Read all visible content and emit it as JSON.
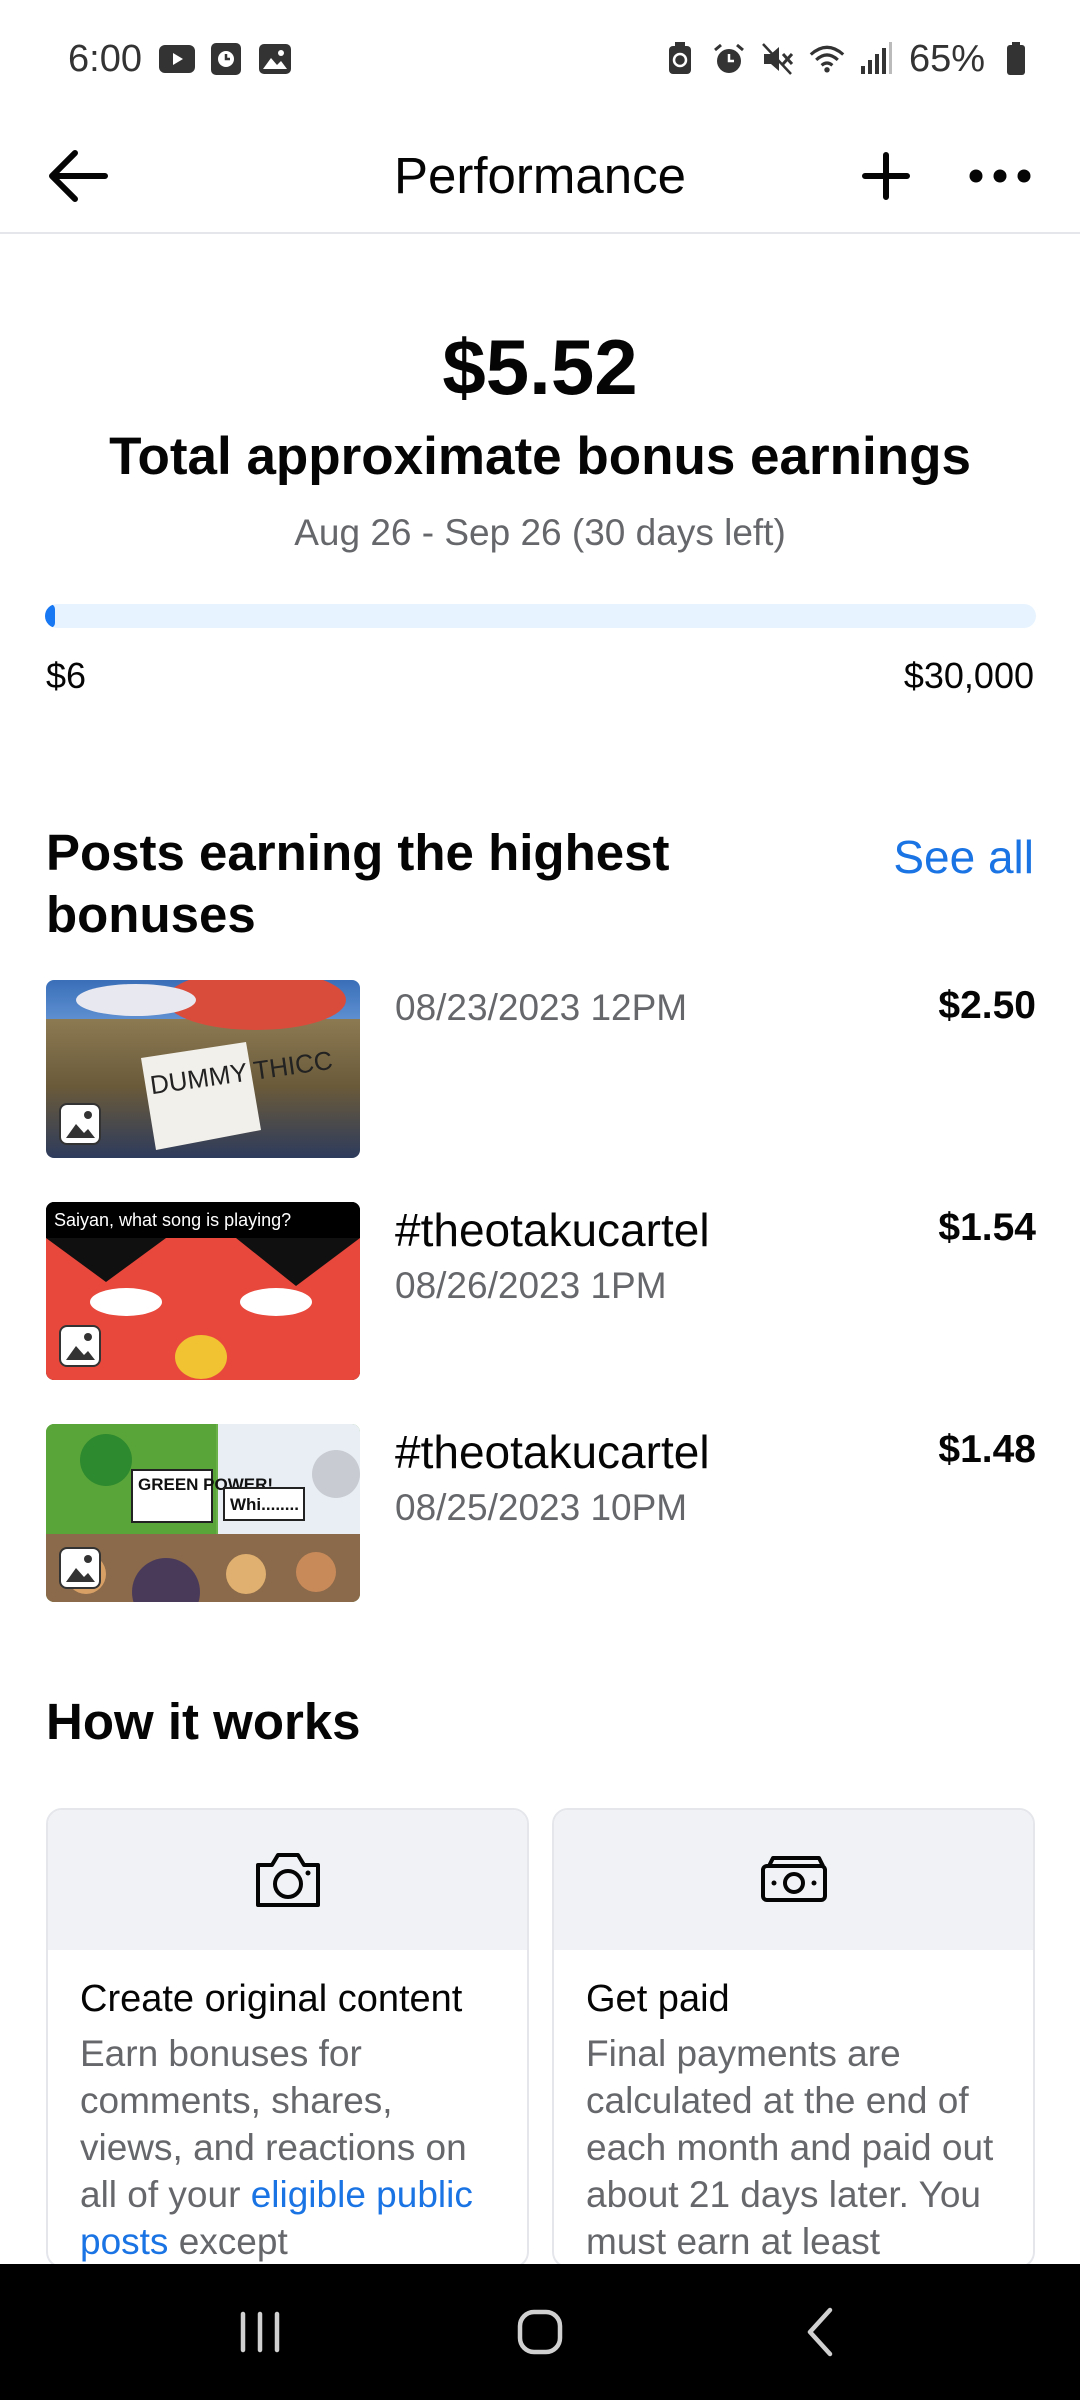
{
  "status_bar": {
    "time": "6:00",
    "battery": "65%",
    "left_icons": [
      "youtube-icon",
      "clock-app-icon",
      "gallery-icon"
    ],
    "right_icons": [
      "battery-saver-icon",
      "alarm-icon",
      "mute-icon",
      "wifi-icon",
      "signal-icon",
      "battery-icon"
    ]
  },
  "header": {
    "title": "Performance",
    "back_icon": "back-arrow-icon",
    "add_icon": "plus-icon",
    "more_icon": "more-icon"
  },
  "earnings": {
    "amount": "$5.52",
    "label": "Total approximate bonus earnings",
    "period": "Aug 26 - Sep 26 (30 days left)",
    "progress": {
      "fraction": 0.0002,
      "min_label": "$6",
      "max_label": "$30,000"
    }
  },
  "posts_section": {
    "heading": "Posts earning the highest bonuses",
    "see_all": "See all",
    "posts": [
      {
        "title": "",
        "date": "08/23/2023 12PM",
        "amount": "$2.50",
        "thumb_text": "DUMMY THICC"
      },
      {
        "title": "#theotakucartel",
        "date": "08/26/2023 1PM",
        "amount": "$1.54",
        "thumb_text": "Saiyan, what song is playing?"
      },
      {
        "title": "#theotakucartel",
        "date": "08/25/2023 10PM",
        "amount": "$1.48",
        "thumb_text": "GREEN POWER!",
        "thumb_text_2": "Whi........"
      }
    ]
  },
  "how_it_works": {
    "heading": "How it works",
    "cards": [
      {
        "icon": "camera-icon",
        "title": "Create original content",
        "body_before": "Earn bonuses for comments, shares, views, and reactions on all of your ",
        "body_link": "eligible public posts",
        "body_after": " except"
      },
      {
        "icon": "money-icon",
        "title": "Get paid",
        "body": "Final payments are calculated at the end of each month and paid out about 21 days later. You must earn at least"
      }
    ]
  },
  "nav_bar": {
    "icons": [
      "recent-apps-icon",
      "home-icon",
      "nav-back-icon"
    ]
  },
  "colors": {
    "accent": "#1877f2",
    "link": "#1b74e4",
    "secondary_text": "#65676b",
    "track": "#e7f3ff"
  }
}
